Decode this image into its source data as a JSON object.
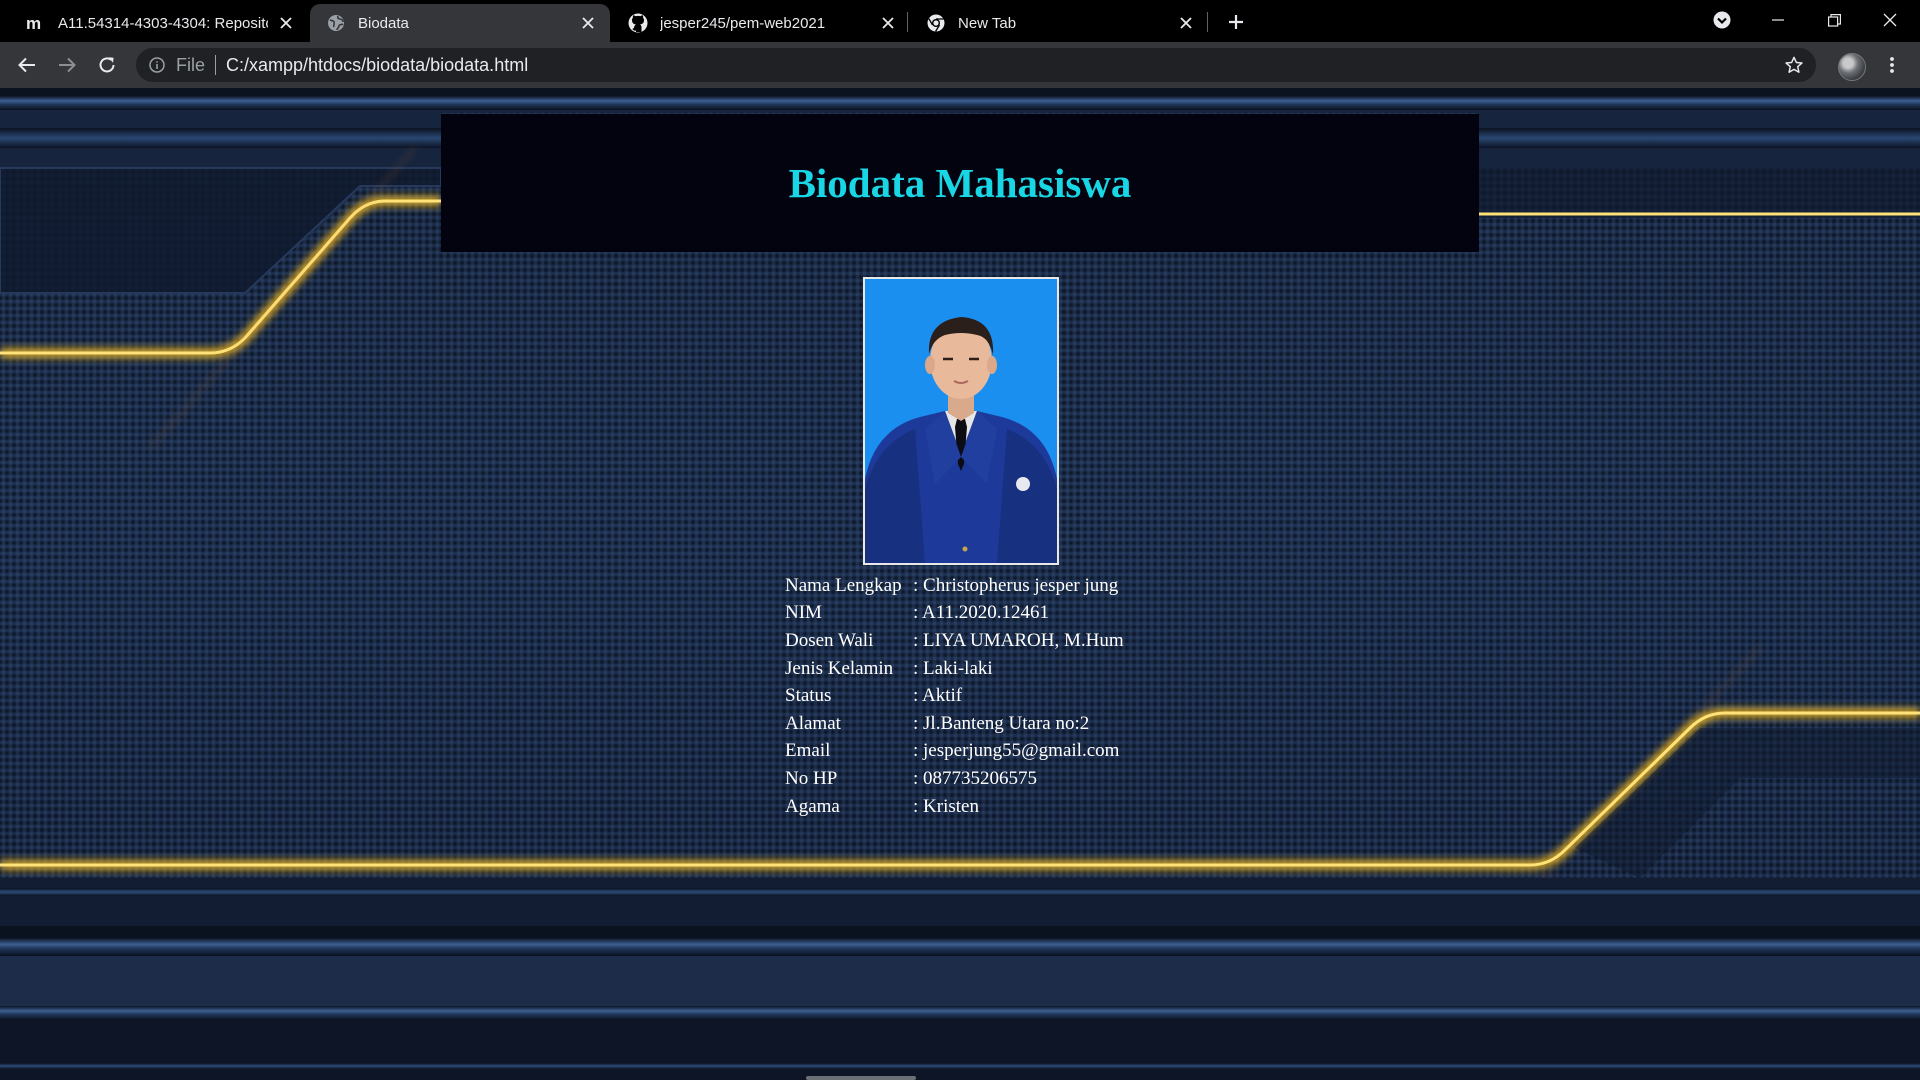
{
  "browser": {
    "tabs": [
      {
        "label": "A11.54314-4303-4304: Repositor",
        "icon": "moodle-icon",
        "active": false
      },
      {
        "label": "Biodata",
        "icon": "globe-icon",
        "active": true
      },
      {
        "label": "jesper245/pem-web2021",
        "icon": "github-icon",
        "active": false
      },
      {
        "label": "New Tab",
        "icon": "chrome-icon",
        "active": false
      }
    ],
    "address": {
      "scheme_label": "File",
      "url": "C:/xampp/htdocs/biodata/biodata.html"
    }
  },
  "page": {
    "title": "Biodata Mahasiswa",
    "photo_alt": "Foto mahasiswa",
    "fields": [
      {
        "label": "Nama Lengkap",
        "value": ": Christopherus jesper jung"
      },
      {
        "label": "NIM",
        "value": ": A11.2020.12461"
      },
      {
        "label": "Dosen Wali",
        "value": ": LIYA UMAROH, M.Hum"
      },
      {
        "label": "Jenis Kelamin",
        "value": ": Laki-laki"
      },
      {
        "label": "Status",
        "value": ": Aktif"
      },
      {
        "label": "Alamat",
        "value": ": Jl.Banteng Utara no:2"
      },
      {
        "label": "Email",
        "value": ": jesperjung55@gmail.com"
      },
      {
        "label": "No HP",
        "value": ": 087735206575"
      },
      {
        "label": "Agama",
        "value": ": Kristen"
      }
    ]
  },
  "colors": {
    "title": "#18d6e4",
    "header_bg": "#02030f",
    "gold_line": "#ffc21a",
    "tab_active": "#35363a"
  }
}
